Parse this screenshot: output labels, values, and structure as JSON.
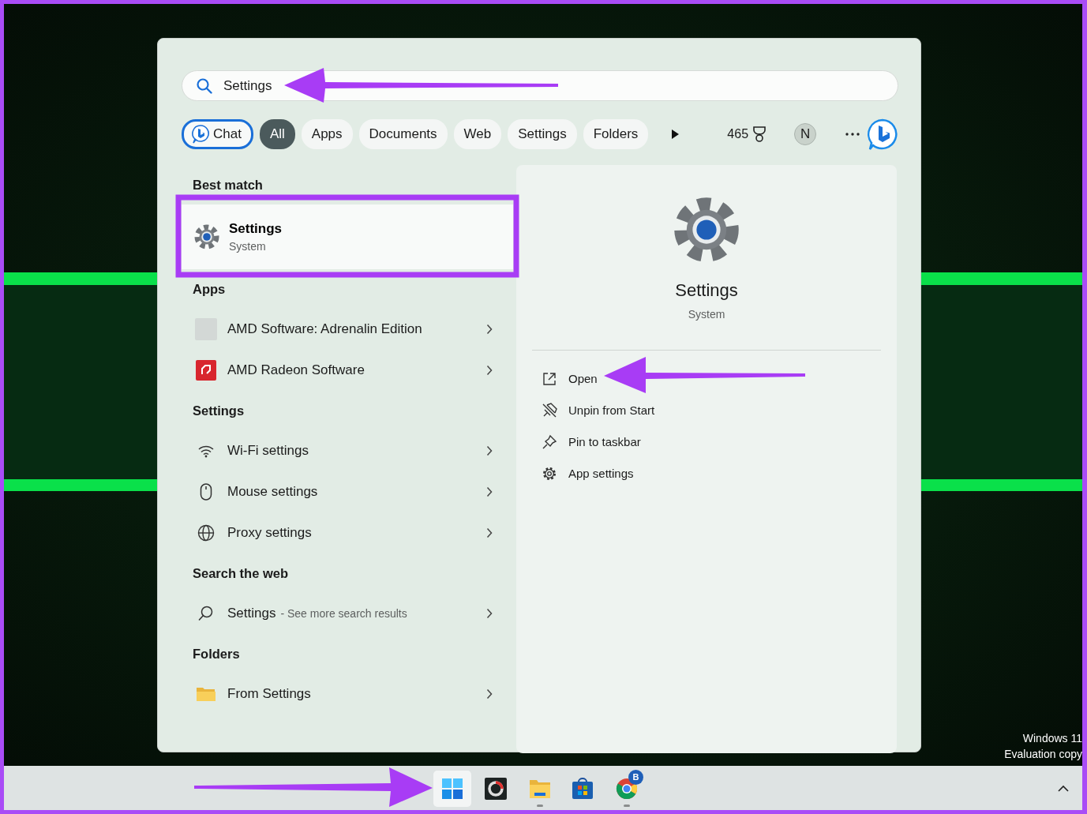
{
  "search": {
    "value": "Settings"
  },
  "filters": [
    {
      "kind": "chat",
      "label": "Chat",
      "selected": false
    },
    {
      "kind": "chip",
      "label": "All",
      "selected": true
    },
    {
      "kind": "chip",
      "label": "Apps",
      "selected": false
    },
    {
      "kind": "chip",
      "label": "Documents",
      "selected": false
    },
    {
      "kind": "chip",
      "label": "Web",
      "selected": false
    },
    {
      "kind": "chip",
      "label": "Settings",
      "selected": false
    },
    {
      "kind": "chip",
      "label": "Folders",
      "selected": false
    }
  ],
  "rewards": {
    "points": "465"
  },
  "profile": {
    "initial": "N"
  },
  "best_match": {
    "heading": "Best match",
    "title": "Settings",
    "subtitle": "System",
    "selected": true
  },
  "sections": [
    {
      "heading": "Apps",
      "items": [
        {
          "kind": "blank",
          "label": "AMD Software: Adrenalin Edition"
        },
        {
          "kind": "amd",
          "label": "AMD Radeon Software"
        }
      ]
    },
    {
      "heading": "Settings",
      "items": [
        {
          "kind": "wifi",
          "label": "Wi-Fi settings"
        },
        {
          "kind": "mouse",
          "label": "Mouse settings"
        },
        {
          "kind": "globe",
          "label": "Proxy settings"
        }
      ]
    },
    {
      "heading": "Search the web",
      "items": [
        {
          "kind": "search",
          "label": "Settings",
          "note": "- See more search results"
        }
      ]
    },
    {
      "heading": "Folders",
      "items": [
        {
          "kind": "folder",
          "label": "From Settings"
        }
      ]
    }
  ],
  "detail": {
    "title": "Settings",
    "subtitle": "System",
    "actions": [
      {
        "kind": "open",
        "label": "Open"
      },
      {
        "kind": "unpin",
        "label": "Unpin from Start"
      },
      {
        "kind": "pin",
        "label": "Pin to taskbar"
      },
      {
        "kind": "gear",
        "label": "App settings"
      }
    ]
  },
  "taskbar": {
    "apps": [
      {
        "kind": "start",
        "active": true,
        "running": false
      },
      {
        "kind": "ring",
        "active": false,
        "running": false
      },
      {
        "kind": "folder",
        "active": false,
        "running": true
      },
      {
        "kind": "store",
        "active": false,
        "running": false
      },
      {
        "kind": "chrome",
        "active": false,
        "running": true,
        "badge": "B"
      }
    ]
  },
  "watermark": [
    "Windows 11",
    "Evaluation copy"
  ],
  "annotations": [
    {
      "kind": "arrow"
    },
    {
      "kind": "highlight"
    },
    {
      "kind": "arrow"
    },
    {
      "kind": "arrow"
    }
  ]
}
